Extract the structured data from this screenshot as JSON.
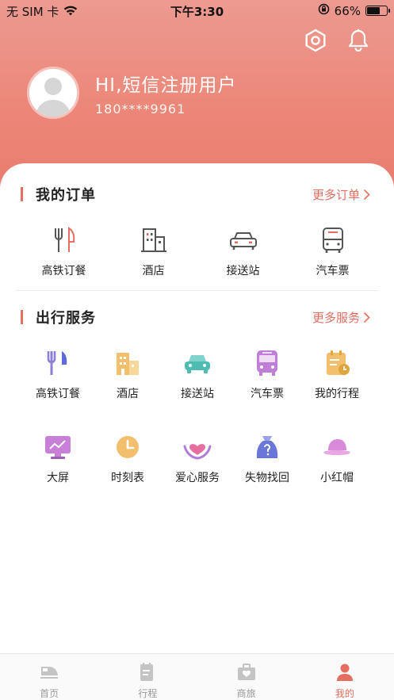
{
  "status_bar": {
    "carrier": "无 SIM 卡",
    "time": "下午3:30",
    "battery": "66%",
    "battery_level": 0.66
  },
  "header": {
    "icons": [
      "settings-icon",
      "bell-icon"
    ]
  },
  "profile": {
    "greeting": "HI,短信注册用户",
    "phone": "180****9961"
  },
  "orders": {
    "title": "我的订单",
    "more": "更多订单",
    "items": [
      {
        "label": "高铁订餐",
        "icon": "cutlery-icon"
      },
      {
        "label": "酒店",
        "icon": "hotel-icon"
      },
      {
        "label": "接送站",
        "icon": "car-icon"
      },
      {
        "label": "汽车票",
        "icon": "bus-icon"
      }
    ]
  },
  "services": {
    "title": "出行服务",
    "more": "更多服务",
    "row1": [
      {
        "label": "高铁订餐",
        "icon": "cutlery-icon"
      },
      {
        "label": "酒店",
        "icon": "hotel-icon"
      },
      {
        "label": "接送站",
        "icon": "car-icon"
      },
      {
        "label": "汽车票",
        "icon": "bus-icon"
      },
      {
        "label": "我的行程",
        "icon": "itinerary-icon"
      }
    ],
    "row2": [
      {
        "label": "大屏",
        "icon": "screen-icon"
      },
      {
        "label": "时刻表",
        "icon": "clock-icon"
      },
      {
        "label": "爱心服务",
        "icon": "heart-hands-icon"
      },
      {
        "label": "失物找回",
        "icon": "lost-bag-icon"
      },
      {
        "label": "小红帽",
        "icon": "red-cap-icon"
      }
    ]
  },
  "colors": {
    "accent": "#e46e60",
    "hero_top": "#ec9a90",
    "hero_bottom": "#e97b6d"
  },
  "tabs": [
    {
      "label": "首页",
      "icon": "train-icon",
      "active": false
    },
    {
      "label": "行程",
      "icon": "itinerary-icon",
      "active": false
    },
    {
      "label": "商旅",
      "icon": "suitcase-icon",
      "active": false
    },
    {
      "label": "我的",
      "icon": "user-icon",
      "active": true
    }
  ]
}
